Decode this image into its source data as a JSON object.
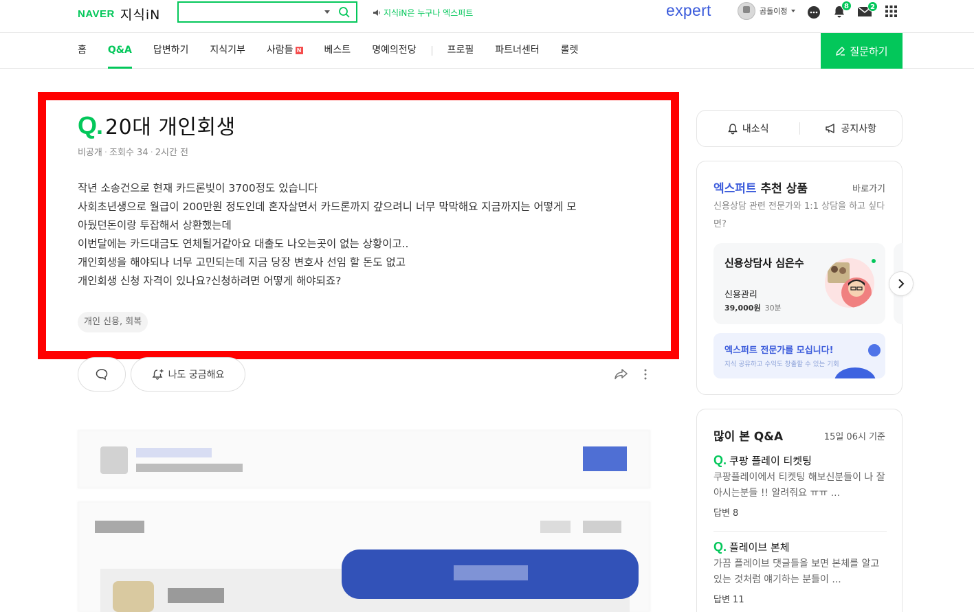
{
  "header": {
    "logo_naver": "NAVER",
    "logo_service": "지식iN",
    "search": {
      "value": "",
      "placeholder": ""
    },
    "promo_text": "지식iN은 누구나 엑스퍼트",
    "expert_logo": "expert",
    "user_name": "곰돌이정",
    "notifications_count": "8",
    "messages_count": "2",
    "brand_color": "#03c75a",
    "expert_color": "#3b5bdb"
  },
  "nav": {
    "items": [
      "홈",
      "Q&A",
      "답변하기",
      "지식기부",
      "사람들",
      "베스트",
      "명예의전당",
      "프로필",
      "파트너센터",
      "롤렛"
    ],
    "active": "Q&A",
    "new_badge": "N",
    "ask_button": "질문하기"
  },
  "question": {
    "q_mark": "Q.",
    "title": "20대 개인회생",
    "visibility": "비공개",
    "views": "조회수 34",
    "time": "2시간 전",
    "body": [
      "작년 소송건으로 현재 카드론빚이 3700정도 있습니다",
      "사회초년생으로 월급이 200만원 정도인데 혼자살면서 카드론까지 갚으려니 너무 막막해요 지금까지는 어떻게 모",
      "아뒀던돈이랑 투잡해서 상환했는데",
      "이번달에는 카드대금도 연체될거같아요 대출도 나오는곳이 없는 상황이고..",
      "개인회생을 해야되나 너무 고민되는데 지금 당장 변호사 선임 할 돈도 없고",
      "개인회생 신청 자격이 있나요?신청하려면 어떻게 해야되죠?"
    ],
    "tag": "개인 신용, 회복",
    "curious_button": "나도 궁금해요"
  },
  "sidebar": {
    "notif_label": "내소식",
    "notice_label": "공지사항",
    "recommend": {
      "title_blue": "엑스퍼트",
      "title_rest": " 추천 상품",
      "go_link": "바로가기",
      "desc": "신용상담 관련 전문가와 1:1 상담을 하고 싶다면?",
      "consultant_name": "신용상담사 심은수",
      "product": "신용관리",
      "price": "39,000원",
      "duration": "30분",
      "recruit_title": "엑스퍼트 전문가를 모십니다!",
      "recruit_desc": "지식 공유하고 수익도 창출할 수 있는 기회"
    },
    "popular": {
      "title": "많이 본 Q&A",
      "date": "15일 06시 기준",
      "items": [
        {
          "q": "Q.",
          "title": "쿠팡 플레이 티켓팅",
          "desc": "쿠팡플레이에서 티켓팅 해보신분들이 나 잘 아시는분들 !! 알려줘요 ㅠㅠ ...",
          "answers": "답변 8"
        },
        {
          "q": "Q.",
          "title": "플레이브 본체",
          "desc": "가끔 플레이브 댓글들을 보면 본체를 알고 있는 것처럼 얘기하는 분들이 ...",
          "answers": "답변 11"
        }
      ]
    }
  }
}
